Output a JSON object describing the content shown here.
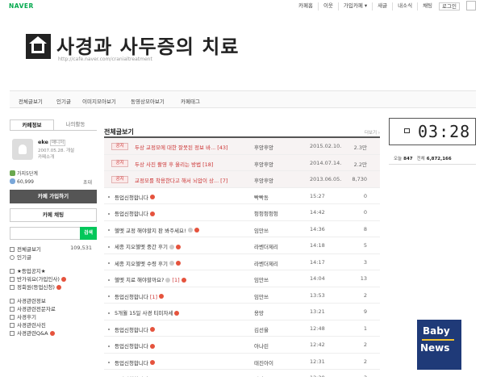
{
  "top": {
    "logo": "NAVER",
    "nav": [
      "카페홈",
      "이웃",
      "가입카페 ▾",
      "새글",
      "내소식",
      "채팅",
      "로그인"
    ]
  },
  "banner": {
    "title": "사경과 사두증의 치료",
    "url": "http://cafe.naver.com/cranialtreatment"
  },
  "menu": [
    "전체글보기",
    "인기글",
    "이미지모아보기",
    "동영상모아보기",
    "카페태그"
  ],
  "sidebar": {
    "tabs": [
      "카페정보",
      "나의활동"
    ],
    "profile": {
      "nick": "eke",
      "badge": "매니저",
      "joined": "2007.05.28. 개설",
      "intro": "카페소개"
    },
    "level": "가지5단계",
    "members": "60,999",
    "invite": "초대",
    "join_button": "카페 가입하기",
    "chat_button": "카페 채팅",
    "search_button": "검색",
    "boards": [
      {
        "label": "전체글보기",
        "count": "109,531"
      },
      {
        "label": "인기글",
        "count": ""
      }
    ],
    "boards2": [
      {
        "label": "★등업공지★",
        "new": false
      },
      {
        "label": "반가워요(가입인사)",
        "new": true
      },
      {
        "label": "정회원(등업신청)",
        "new": true
      }
    ],
    "boards3": [
      {
        "label": "사경관련정보",
        "new": false
      },
      {
        "label": "사경관련전문자료",
        "new": false
      },
      {
        "label": "사경후기",
        "new": false
      },
      {
        "label": "사경관련사진",
        "new": false
      },
      {
        "label": "사경관련Q&A",
        "new": true
      }
    ]
  },
  "main": {
    "title": "전체글보기",
    "more": "더보기 ›",
    "notices": [
      {
        "tag": "공지",
        "subject": "두상 교정모에 대한 잘못된 정보 바...",
        "comments": "[43]",
        "author": "후앙후앙",
        "date": "2015.02.10.",
        "views": "2.3만"
      },
      {
        "tag": "공지",
        "subject": "두상 사진 촬영 후 올리는 방법",
        "comments": "[18]",
        "author": "후앙후앙",
        "date": "2014.07.14.",
        "views": "2.2만"
      },
      {
        "tag": "공지",
        "subject": "교정모를 착용한다고 해서 뇌압이 상...",
        "comments": "[7]",
        "author": "후앙후앙",
        "date": "2013.06.05.",
        "views": "8,730"
      }
    ],
    "posts": [
      {
        "subject": "등업신청합니다",
        "cc": "",
        "new": true,
        "emo": false,
        "author": "빡빡동",
        "date": "15:27",
        "views": "0"
      },
      {
        "subject": "등업신청합니다",
        "cc": "",
        "new": true,
        "emo": false,
        "author": "헝헝헝헝헝",
        "date": "14:42",
        "views": "0"
      },
      {
        "subject": "헬멧 교정 해야할지 판 봐주세요!",
        "cc": "",
        "new": true,
        "emo": true,
        "author": "임만쓰",
        "date": "14:36",
        "views": "8"
      },
      {
        "subject": "세종 지오헬멧 중간 후기",
        "cc": "",
        "new": true,
        "emo": true,
        "author": "라벤더제리",
        "date": "14:18",
        "views": "5"
      },
      {
        "subject": "세종 지오헬멧 수령 후기",
        "cc": "",
        "new": true,
        "emo": true,
        "author": "라벤더제리",
        "date": "14:17",
        "views": "3"
      },
      {
        "subject": "헬멧 치료 해야할까요?",
        "cc": "[1]",
        "new": true,
        "emo": true,
        "author": "임만쓰",
        "date": "14:04",
        "views": "13"
      },
      {
        "subject": "등업신청합니다",
        "cc": "[1]",
        "new": true,
        "emo": false,
        "author": "임만쓰",
        "date": "13:53",
        "views": "2"
      },
      {
        "subject": "5개월 15일 사경 티미자세",
        "cc": "",
        "new": true,
        "emo": false,
        "author": "용망",
        "date": "13:21",
        "views": "9"
      },
      {
        "subject": "등업신청합니다",
        "cc": "",
        "new": true,
        "emo": false,
        "author": "김선율",
        "date": "12:48",
        "views": "1"
      },
      {
        "subject": "등업신청합니다",
        "cc": "",
        "new": true,
        "emo": false,
        "author": "아나린",
        "date": "12:42",
        "views": "2"
      },
      {
        "subject": "등업신청합니다",
        "cc": "",
        "new": true,
        "emo": false,
        "author": "태진아이",
        "date": "12:31",
        "views": "2"
      },
      {
        "subject": "등업신청합니다!",
        "cc": "[3]",
        "new": true,
        "emo": false,
        "author": "이마트24",
        "date": "12:29",
        "views": "3"
      }
    ]
  },
  "clock": {
    "time": "03:28"
  },
  "visitors": {
    "today_label": "오늘",
    "today": "847",
    "total_label": "전체",
    "total": "6,872,166"
  },
  "watermark": {
    "line1": "Baby",
    "line2": "News"
  }
}
